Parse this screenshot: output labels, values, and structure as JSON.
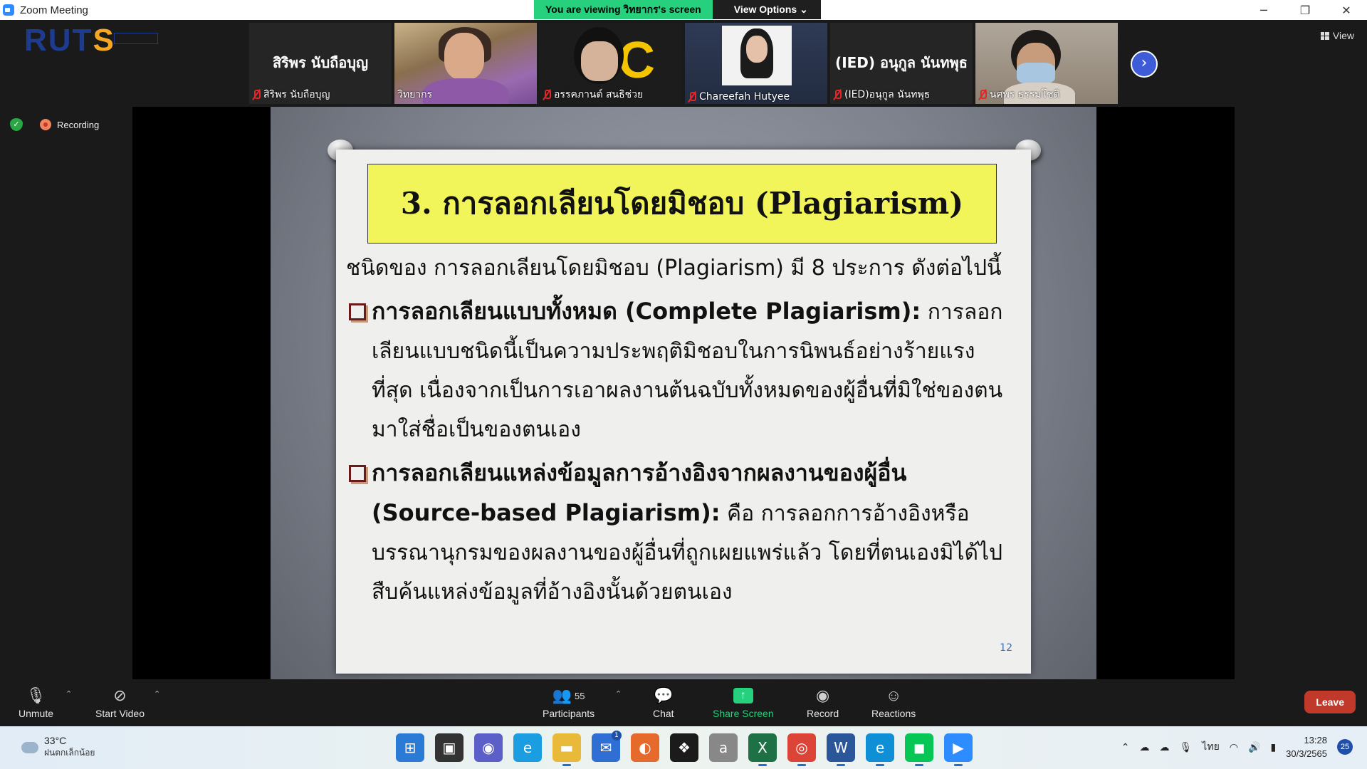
{
  "window": {
    "title": "Zoom Meeting",
    "viewing_banner": "You are viewing วิทยากร's screen",
    "view_options": "View Options"
  },
  "strip": {
    "logo": {
      "part1": "RUT",
      "part2": "S"
    },
    "tiles": [
      {
        "big_name": "สิริพร นับถือบุญ",
        "name": "สิริพร นับถือบุญ",
        "muted": true
      },
      {
        "name": "วิทยากร",
        "muted": false
      },
      {
        "name": "อรรคภานต์ สนธิช่วย",
        "muted": true
      },
      {
        "name": "Chareefah Hutyee",
        "muted": true
      },
      {
        "big_name": "(IED) อนุกูล นันทพุธ",
        "name": "(IED)อนุกูล นันทพุธ",
        "muted": true
      },
      {
        "name": "นศพร ธรรมโชติ",
        "muted": true
      }
    ],
    "view_label": "View"
  },
  "status": {
    "recording_label": "Recording"
  },
  "slide": {
    "title": "3. การลอกเลียนโดยมิชอบ (Plagiarism)",
    "intro": "ชนิดของ การลอกเลียนโดยมิชอบ (Plagiarism) มี 8 ประการ ดังต่อไปนี้",
    "bullets": [
      {
        "head": "การลอกเลียนแบบทั้งหมด (Complete Plagiarism):",
        "text": " การลอกเลียนแบบชนิดนี้เป็นความประพฤติมิชอบในการนิพนธ์อย่างร้ายแรงที่สุด เนื่องจากเป็นการเอาผลงานต้นฉบับทั้งหมดของผู้อื่นที่มิใช่ของตนมาใส่ชื่อเป็นของตนเอง"
      },
      {
        "head": "การลอกเลียนแหล่งข้อมูลการอ้างอิงจากผลงานของผู้อื่น (Source-based Plagiarism):",
        "text": " คือ การลอกการอ้างอิงหรือบรรณานุกรมของผลงานของผู้อื่นที่ถูกเผยแพร่แล้ว โดยที่ตนเองมิได้ไปสืบค้นแหล่งข้อมูลที่อ้างอิงนั้นด้วยตนเอง"
      }
    ],
    "page_number": "12"
  },
  "toolbar": {
    "unmute": "Unmute",
    "start_video": "Start Video",
    "participants": "Participants",
    "participants_count": "55",
    "chat": "Chat",
    "share_screen": "Share Screen",
    "record": "Record",
    "reactions": "Reactions",
    "leave": "Leave"
  },
  "taskbar": {
    "temperature": "33°C",
    "weather": "ฝนตกเล็กน้อย",
    "language": "ไทย",
    "time": "13:28",
    "date": "30/3/2565",
    "notifications": "25",
    "mail_badge": "1"
  },
  "colors": {
    "zoom_green": "#26d07c",
    "zoom_blue": "#2D8CFF",
    "slide_title_bg": "#f2f55a",
    "leave_red": "#c0392b"
  }
}
